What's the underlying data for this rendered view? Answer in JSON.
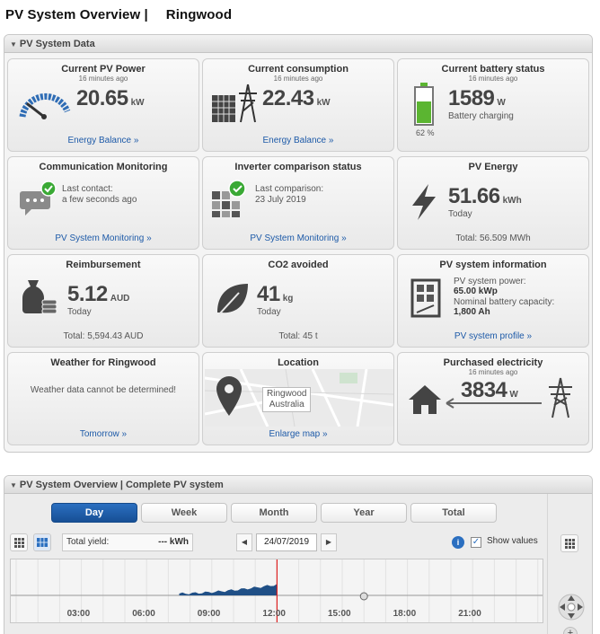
{
  "page": {
    "title": "PV System Overview |",
    "site": "Ringwood"
  },
  "data_panel": {
    "header": "PV System Data"
  },
  "tiles": {
    "pv_power": {
      "title": "Current PV Power",
      "sub": "16 minutes ago",
      "value": "20.65",
      "unit": "kW",
      "link": "Energy Balance »"
    },
    "consumption": {
      "title": "Current consumption",
      "sub": "16 minutes ago",
      "value": "22.43",
      "unit": "kW",
      "link": "Energy Balance »"
    },
    "battery": {
      "title": "Current battery status",
      "sub": "16 minutes ago",
      "value": "1589",
      "unit": "W",
      "status": "Battery charging",
      "percent": "62 %",
      "charge_fraction": 0.62
    },
    "comm": {
      "title": "Communication Monitoring",
      "line1": "Last contact:",
      "line2": "a few seconds ago",
      "link": "PV System Monitoring »"
    },
    "inverter": {
      "title": "Inverter comparison status",
      "line1": "Last comparison:",
      "line2": "23 July 2019",
      "link": "PV System Monitoring »"
    },
    "energy": {
      "title": "PV Energy",
      "value": "51.66",
      "unit": "kWh",
      "period": "Today",
      "total": "Total: 56.509 MWh"
    },
    "reimb": {
      "title": "Reimbursement",
      "value": "5.12",
      "unit": "AUD",
      "period": "Today",
      "total": "Total: 5,594.43 AUD"
    },
    "co2": {
      "title": "CO2 avoided",
      "value": "41",
      "unit": "kg",
      "period": "Today",
      "total": "Total: 45 t"
    },
    "info": {
      "title": "PV system information",
      "label1": "PV system power:",
      "value1": "65.00 kWp",
      "label2": "Nominal battery capacity:",
      "value2": "1,800 Ah",
      "link": "PV system profile »"
    },
    "weather": {
      "title": "Weather for Ringwood",
      "message": "Weather data cannot be determined!",
      "link": "Tomorrow »"
    },
    "location": {
      "title": "Location",
      "city": "Ringwood",
      "country": "Australia",
      "link": "Enlarge map »"
    },
    "purchased": {
      "title": "Purchased electricity",
      "sub": "16 minutes ago",
      "value": "3834",
      "unit": "W"
    }
  },
  "overview_panel": {
    "header": "PV System Overview | Complete PV system",
    "tabs": [
      {
        "label": "Day",
        "active": true
      },
      {
        "label": "Week",
        "active": false
      },
      {
        "label": "Month",
        "active": false
      },
      {
        "label": "Year",
        "active": false
      },
      {
        "label": "Total",
        "active": false
      }
    ],
    "yield_label": "Total yield:",
    "yield_value": "--- kWh",
    "date": "24/07/2019",
    "show_values_label": "Show values",
    "xticks": [
      "03:00",
      "06:00",
      "09:00",
      "12:00",
      "15:00",
      "18:00",
      "21:00"
    ]
  },
  "colors": {
    "accent": "#1d5aa8",
    "tab_active": "#1f5ea8",
    "graph_fill": "#1f4f86",
    "battery_green": "#5bb531",
    "check_green": "#3aa935"
  }
}
